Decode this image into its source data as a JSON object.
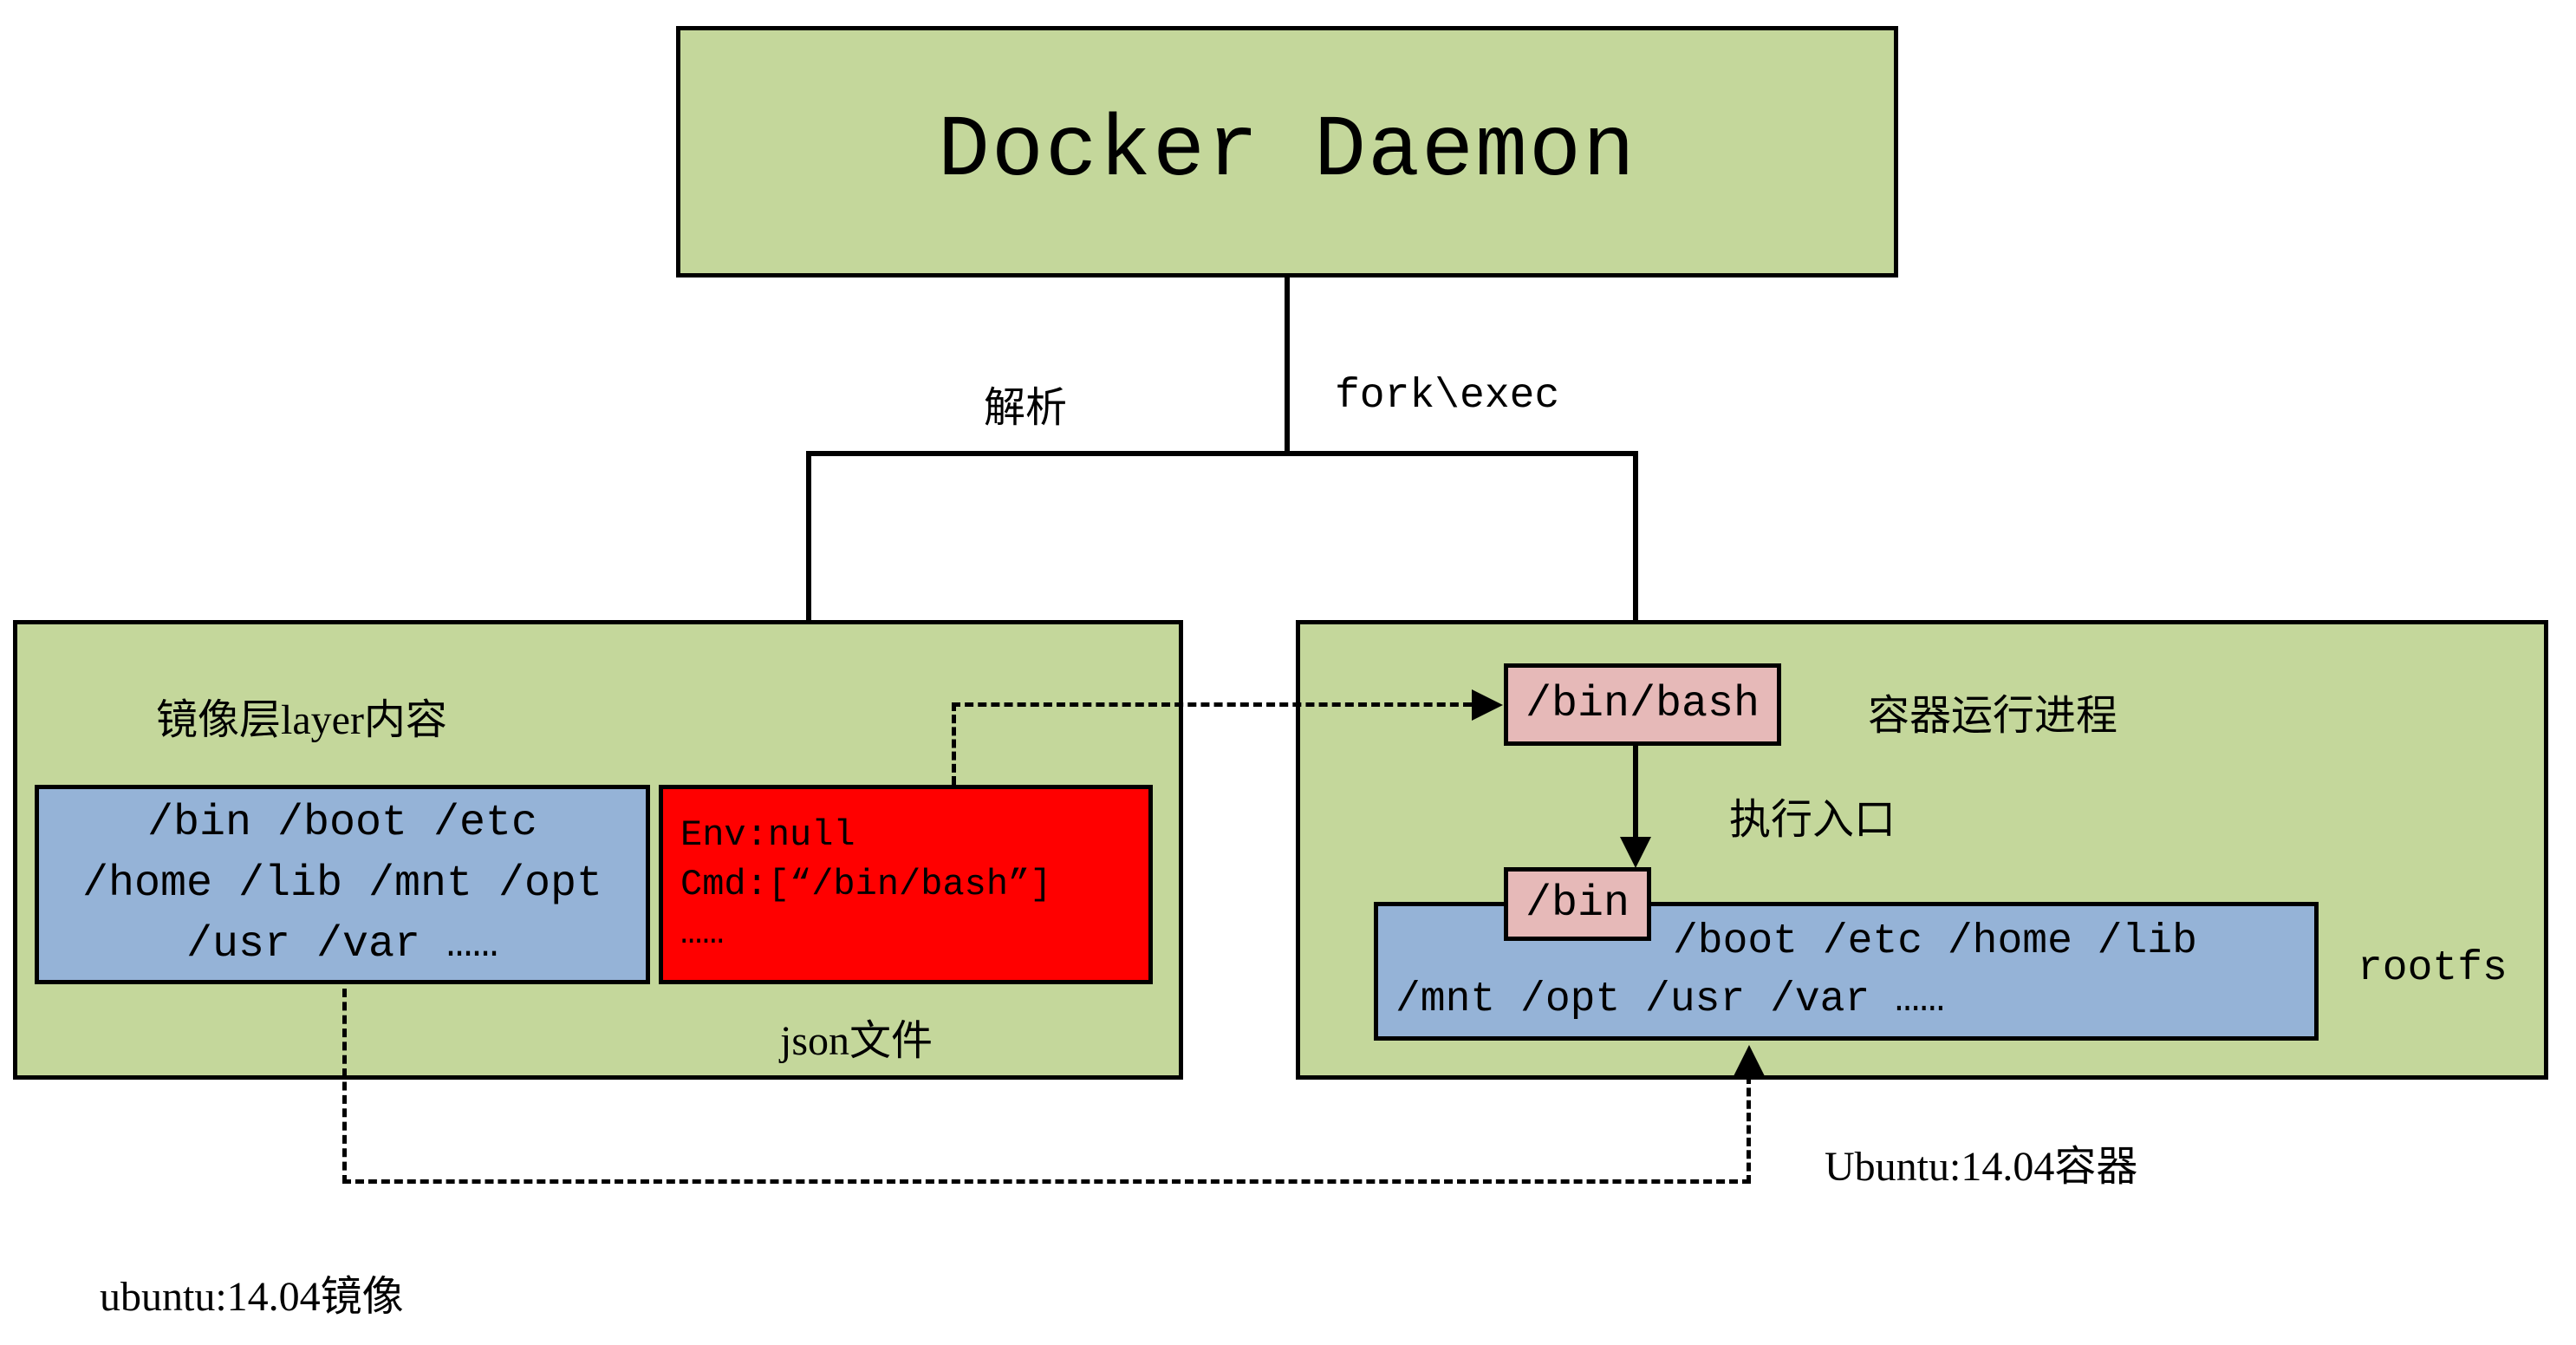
{
  "daemon": {
    "title": "Docker Daemon"
  },
  "edges": {
    "parse": "解析",
    "fork_exec": "fork\\exec",
    "entry": "执行入口"
  },
  "image_panel": {
    "heading": "镜像层layer内容",
    "layer_line1": "/bin /boot /etc",
    "layer_line2": "/home /lib /mnt /opt",
    "layer_line3": "/usr /var ……",
    "json_line1": "Env:null",
    "json_line2": "Cmd:[“/bin/bash”]",
    "json_line3": "……",
    "json_label": "json文件",
    "caption": "ubuntu:14.04镜像"
  },
  "container_panel": {
    "binbash": "/bin/bash",
    "proc_label": "容器运行进程",
    "bin": "/bin",
    "rootfs_line1": "/boot /etc /home /lib",
    "rootfs_line2": "/mnt /opt /usr /var ……",
    "rootfs_label": "rootfs",
    "caption": "Ubuntu:14.04容器"
  }
}
